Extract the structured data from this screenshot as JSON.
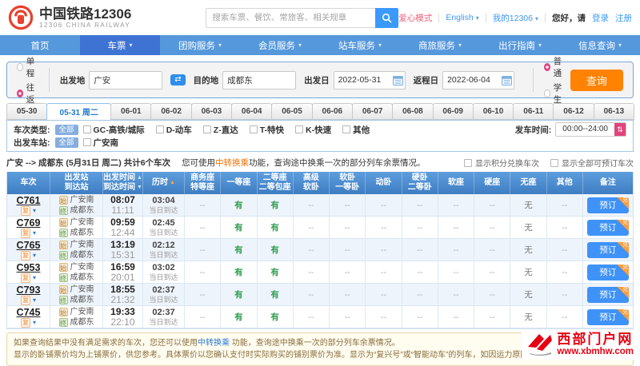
{
  "header": {
    "logo_title": "中国铁路12306",
    "logo_subtitle": "12306 CHINA RAILWAY",
    "search_placeholder": "搜索车票、餐饮、常旅客、相关规章",
    "links": {
      "care": "爱心模式",
      "lang": "English",
      "my": "我的12306",
      "greet": "您好，请",
      "login": "登录",
      "register": "注册"
    }
  },
  "nav": {
    "items": [
      {
        "label": "首页",
        "caret": ""
      },
      {
        "label": "车票",
        "caret": "▾",
        "active": true
      },
      {
        "label": "团购服务",
        "caret": "▾"
      },
      {
        "label": "会员服务",
        "caret": "▾"
      },
      {
        "label": "站车服务",
        "caret": "▾"
      },
      {
        "label": "商旅服务",
        "caret": "▾"
      },
      {
        "label": "出行指南",
        "caret": "▾"
      },
      {
        "label": "信息查询",
        "caret": "▾"
      }
    ]
  },
  "booking": {
    "trip_types": [
      {
        "label": "单程",
        "selected": false
      },
      {
        "label": "往返",
        "selected": true
      }
    ],
    "from_label": "出发地",
    "from_value": "广安",
    "to_label": "目的地",
    "to_value": "成都东",
    "depart_label": "出发日",
    "depart_value": "2022-05-31",
    "return_label": "返程日",
    "return_value": "2022-06-04",
    "passenger_types": [
      {
        "label": "普通",
        "selected": true
      },
      {
        "label": "学生",
        "selected": false
      }
    ],
    "search_button": "查询"
  },
  "date_tabs": [
    {
      "label": "05-30"
    },
    {
      "label": "05-31 周二",
      "active": true
    },
    {
      "label": "06-01"
    },
    {
      "label": "06-02"
    },
    {
      "label": "06-03"
    },
    {
      "label": "06-04"
    },
    {
      "label": "06-05"
    },
    {
      "label": "06-06"
    },
    {
      "label": "06-07"
    },
    {
      "label": "06-08"
    },
    {
      "label": "06-09"
    },
    {
      "label": "06-10"
    },
    {
      "label": "06-11"
    },
    {
      "label": "06-12"
    },
    {
      "label": "06-13"
    }
  ],
  "filters": {
    "type_label": "车次类型:",
    "all_badge": "全部",
    "type_options": [
      "GC-高铁/城际",
      "D-动车",
      "Z-直达",
      "T-特快",
      "K-快速",
      "其他"
    ],
    "depart_time_label": "发车时间:",
    "depart_time_value": "00:00--24:00",
    "station_label": "出发车站:",
    "station_options": [
      "广安南"
    ]
  },
  "summary": {
    "route": "广安 --> 成都东 (5月31日 周二) 共计6个车次",
    "tip_pre": "您可使用",
    "tip_link": "中转换乘",
    "tip_post": "功能，查询途中换乘一次的部分列车余票情况。",
    "toggles": [
      "显示积分兑换车次",
      "显示全部可预订车次"
    ]
  },
  "table": {
    "headers": [
      {
        "l1": "车次",
        "l2": "",
        "a1": "",
        "a2": "",
        "cls": "c-no"
      },
      {
        "l1": "出发站",
        "l2": "到达站",
        "a1": "",
        "a2": "",
        "cls": "c-st"
      },
      {
        "l1": "出发时间",
        "l2": "到达时间",
        "a1": "▲",
        "a2": "▼",
        "cls": "c-time"
      },
      {
        "l1": "历时",
        "l2": "",
        "a1": "▲",
        "a2": "",
        "cls": "c-dur sort-orange"
      },
      {
        "l1": "商务座",
        "l2": "特等座",
        "a1": "",
        "a2": "",
        "cls": "c-seat"
      },
      {
        "l1": "一等座",
        "l2": "",
        "a1": "",
        "a2": "",
        "cls": "c-seat"
      },
      {
        "l1": "二等座",
        "l2": "二等包座",
        "a1": "",
        "a2": "",
        "cls": "c-seat"
      },
      {
        "l1": "高级",
        "l2": "软卧",
        "a1": "",
        "a2": "",
        "cls": "c-seat"
      },
      {
        "l1": "软卧",
        "l2": "一等卧",
        "a1": "",
        "a2": "",
        "cls": "c-seat"
      },
      {
        "l1": "动卧",
        "l2": "",
        "a1": "",
        "a2": "",
        "cls": "c-seat"
      },
      {
        "l1": "硬卧",
        "l2": "二等卧",
        "a1": "",
        "a2": "",
        "cls": "c-seat"
      },
      {
        "l1": "软座",
        "l2": "",
        "a1": "",
        "a2": "",
        "cls": "c-seat"
      },
      {
        "l1": "硬座",
        "l2": "",
        "a1": "",
        "a2": "",
        "cls": "c-seat"
      },
      {
        "l1": "无座",
        "l2": "",
        "a1": "",
        "a2": "",
        "cls": "c-seat"
      },
      {
        "l1": "其他",
        "l2": "",
        "a1": "",
        "a2": "",
        "cls": "c-seat"
      },
      {
        "l1": "备注",
        "l2": "",
        "a1": "",
        "a2": "",
        "cls": "c-book"
      }
    ],
    "trains": [
      {
        "no": "C761",
        "badge": "复",
        "caret": "▾",
        "from_icon": "始",
        "from": "广安南",
        "to_icon": "终",
        "to": "成都东",
        "dep": "08:07",
        "arr": "11:11",
        "dur": "03:04",
        "day": "当日到达",
        "seats": [
          "--",
          "有",
          "有",
          "--",
          "--",
          "--",
          "--",
          "--",
          "--",
          "无",
          "--"
        ],
        "book": "预订",
        "corner": "兑"
      },
      {
        "no": "C769",
        "badge": "复",
        "caret": "▾",
        "from_icon": "始",
        "from": "广安南",
        "to_icon": "终",
        "to": "成都东",
        "dep": "09:59",
        "arr": "12:44",
        "dur": "02:45",
        "day": "当日到达",
        "seats": [
          "--",
          "有",
          "有",
          "--",
          "--",
          "--",
          "--",
          "--",
          "--",
          "无",
          "--"
        ],
        "book": "预订",
        "corner": "兑"
      },
      {
        "no": "C765",
        "badge": "复",
        "caret": "▾",
        "from_icon": "始",
        "from": "广安南",
        "to_icon": "终",
        "to": "成都东",
        "dep": "13:19",
        "arr": "15:31",
        "dur": "02:12",
        "day": "当日到达",
        "seats": [
          "--",
          "有",
          "有",
          "--",
          "--",
          "--",
          "--",
          "--",
          "--",
          "无",
          "--"
        ],
        "book": "预订",
        "corner": "兑"
      },
      {
        "no": "C953",
        "badge": "复",
        "caret": "▾",
        "from_icon": "始",
        "from": "广安南",
        "to_icon": "终",
        "to": "成都东",
        "dep": "16:59",
        "arr": "20:01",
        "dur": "03:02",
        "day": "当日到达",
        "seats": [
          "--",
          "有",
          "有",
          "--",
          "--",
          "--",
          "--",
          "--",
          "--",
          "无",
          "--"
        ],
        "book": "预订",
        "corner": "兑"
      },
      {
        "no": "C793",
        "badge": "复",
        "caret": "▾",
        "from_icon": "始",
        "from": "广安南",
        "to_icon": "终",
        "to": "成都东",
        "dep": "18:55",
        "arr": "21:32",
        "dur": "02:37",
        "day": "当日到达",
        "seats": [
          "--",
          "有",
          "有",
          "--",
          "--",
          "--",
          "--",
          "--",
          "--",
          "无",
          "--"
        ],
        "book": "预订",
        "corner": "兑"
      },
      {
        "no": "C745",
        "badge": "复",
        "caret": "▾",
        "from_icon": "始",
        "from": "广安南",
        "to_icon": "终",
        "to": "成都东",
        "dep": "19:33",
        "arr": "22:10",
        "dur": "02:37",
        "day": "当日到达",
        "seats": [
          "--",
          "有",
          "有",
          "--",
          "--",
          "--",
          "--",
          "--",
          "--",
          "无",
          "--"
        ],
        "book": "预订",
        "corner": "兑"
      }
    ]
  },
  "notice": {
    "line1_pre": "如果查询结果中没有满足需求的车次，您还可以使用",
    "line1_link": "中转换乘",
    "line1_post": " 功能，查询途中换乘一次的部分列车余票情况。",
    "line2": "显示的卧铺票价均为上铺票价，供您参考。具体票价以您确认支付时实际购买的铺别票价为准。显示为“复兴号”或“智能动车”的列车，如因运力原因或其他不可控因素导致列车调度调整时，当"
  },
  "watermark": {
    "title": "西部门户网",
    "url": "www.xbmhw.com"
  },
  "colors": {
    "accent_blue": "#3b99fc",
    "nav_blue": "#5598dc",
    "nav_active_blue": "#3e73d4",
    "query_orange": "#ff8201",
    "available_green": "#2e9e4f",
    "radio_pink": "#e0417f",
    "watermark_red": "#e60012"
  }
}
